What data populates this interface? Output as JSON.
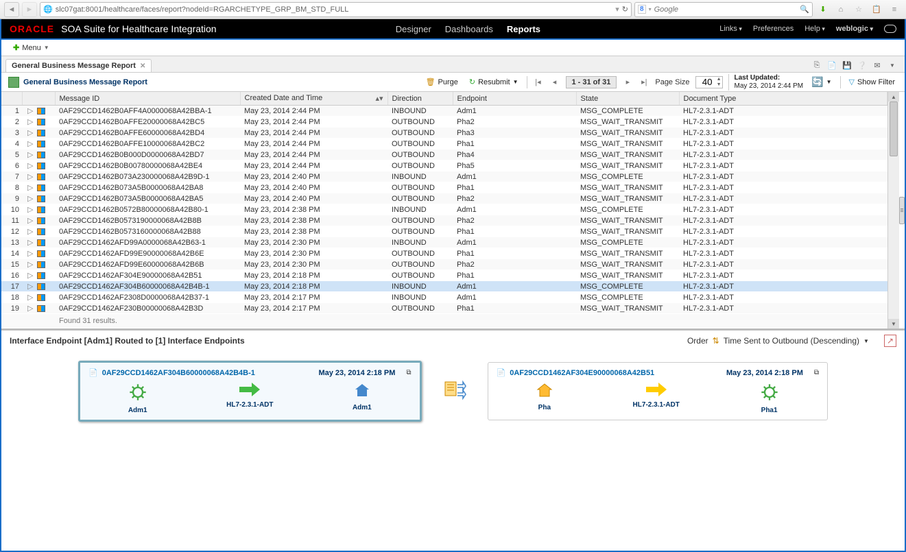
{
  "browser": {
    "url": "slc07gat:8001/healthcare/faces/report?nodeId=RGARCHETYPE_GRP_BM_STD_FULL",
    "search_placeholder": "Google"
  },
  "header": {
    "logo": "ORACLE",
    "suite": "SOA Suite for Healthcare Integration",
    "nav": {
      "designer": "Designer",
      "dashboards": "Dashboards",
      "reports": "Reports"
    },
    "links": "Links",
    "preferences": "Preferences",
    "help": "Help",
    "user": "weblogic"
  },
  "menu_bar": {
    "menu": "Menu"
  },
  "tab": {
    "title": "General Business Message Report"
  },
  "toolbar": {
    "report_title": "General Business Message Report",
    "purge": "Purge",
    "resubmit": "Resubmit",
    "page_info": "1 - 31 of 31",
    "page_size_lbl": "Page Size",
    "page_size_val": "40",
    "last_updated_lbl": "Last Updated:",
    "last_updated_val": "May 23, 2014 2:44 PM",
    "show_filter": "Show Filter"
  },
  "columns": {
    "c0": "",
    "c1": "Message ID",
    "c2": "Created Date and Time",
    "c3": "Direction",
    "c4": "Endpoint",
    "c5": "State",
    "c6": "Document Type"
  },
  "rows": [
    {
      "n": "1",
      "id": "0AF29CCD1462B0AFF4A0000068A42BBA-1",
      "dt": "May 23, 2014 2:44 PM",
      "dir": "INBOUND",
      "ep": "Adm1",
      "st": "MSG_COMPLETE",
      "doc": "HL7-2.3.1-ADT"
    },
    {
      "n": "2",
      "id": "0AF29CCD1462B0AFFE20000068A42BC5",
      "dt": "May 23, 2014 2:44 PM",
      "dir": "OUTBOUND",
      "ep": "Pha2",
      "st": "MSG_WAIT_TRANSMIT",
      "doc": "HL7-2.3.1-ADT"
    },
    {
      "n": "3",
      "id": "0AF29CCD1462B0AFFE60000068A42BD4",
      "dt": "May 23, 2014 2:44 PM",
      "dir": "OUTBOUND",
      "ep": "Pha3",
      "st": "MSG_WAIT_TRANSMIT",
      "doc": "HL7-2.3.1-ADT"
    },
    {
      "n": "4",
      "id": "0AF29CCD1462B0AFFE10000068A42BC2",
      "dt": "May 23, 2014 2:44 PM",
      "dir": "OUTBOUND",
      "ep": "Pha1",
      "st": "MSG_WAIT_TRANSMIT",
      "doc": "HL7-2.3.1-ADT"
    },
    {
      "n": "5",
      "id": "0AF29CCD1462B0B000D0000068A42BD7",
      "dt": "May 23, 2014 2:44 PM",
      "dir": "OUTBOUND",
      "ep": "Pha4",
      "st": "MSG_WAIT_TRANSMIT",
      "doc": "HL7-2.3.1-ADT"
    },
    {
      "n": "6",
      "id": "0AF29CCD1462B0B00780000068A42BE4",
      "dt": "May 23, 2014 2:44 PM",
      "dir": "OUTBOUND",
      "ep": "Pha5",
      "st": "MSG_WAIT_TRANSMIT",
      "doc": "HL7-2.3.1-ADT"
    },
    {
      "n": "7",
      "id": "0AF29CCD1462B073A230000068A42B9D-1",
      "dt": "May 23, 2014 2:40 PM",
      "dir": "INBOUND",
      "ep": "Adm1",
      "st": "MSG_COMPLETE",
      "doc": "HL7-2.3.1-ADT"
    },
    {
      "n": "8",
      "id": "0AF29CCD1462B073A5B0000068A42BA8",
      "dt": "May 23, 2014 2:40 PM",
      "dir": "OUTBOUND",
      "ep": "Pha1",
      "st": "MSG_WAIT_TRANSMIT",
      "doc": "HL7-2.3.1-ADT"
    },
    {
      "n": "9",
      "id": "0AF29CCD1462B073A5B0000068A42BA5",
      "dt": "May 23, 2014 2:40 PM",
      "dir": "OUTBOUND",
      "ep": "Pha2",
      "st": "MSG_WAIT_TRANSMIT",
      "doc": "HL7-2.3.1-ADT"
    },
    {
      "n": "10",
      "id": "0AF29CCD1462B0572B80000068A42B80-1",
      "dt": "May 23, 2014 2:38 PM",
      "dir": "INBOUND",
      "ep": "Adm1",
      "st": "MSG_COMPLETE",
      "doc": "HL7-2.3.1-ADT"
    },
    {
      "n": "11",
      "id": "0AF29CCD1462B0573190000068A42B8B",
      "dt": "May 23, 2014 2:38 PM",
      "dir": "OUTBOUND",
      "ep": "Pha2",
      "st": "MSG_WAIT_TRANSMIT",
      "doc": "HL7-2.3.1-ADT"
    },
    {
      "n": "12",
      "id": "0AF29CCD1462B0573160000068A42B88",
      "dt": "May 23, 2014 2:38 PM",
      "dir": "OUTBOUND",
      "ep": "Pha1",
      "st": "MSG_WAIT_TRANSMIT",
      "doc": "HL7-2.3.1-ADT"
    },
    {
      "n": "13",
      "id": "0AF29CCD1462AFD99A0000068A42B63-1",
      "dt": "May 23, 2014 2:30 PM",
      "dir": "INBOUND",
      "ep": "Adm1",
      "st": "MSG_COMPLETE",
      "doc": "HL7-2.3.1-ADT"
    },
    {
      "n": "14",
      "id": "0AF29CCD1462AFD99E90000068A42B6E",
      "dt": "May 23, 2014 2:30 PM",
      "dir": "OUTBOUND",
      "ep": "Pha1",
      "st": "MSG_WAIT_TRANSMIT",
      "doc": "HL7-2.3.1-ADT"
    },
    {
      "n": "15",
      "id": "0AF29CCD1462AFD99E60000068A42B6B",
      "dt": "May 23, 2014 2:30 PM",
      "dir": "OUTBOUND",
      "ep": "Pha2",
      "st": "MSG_WAIT_TRANSMIT",
      "doc": "HL7-2.3.1-ADT"
    },
    {
      "n": "16",
      "id": "0AF29CCD1462AF304E90000068A42B51",
      "dt": "May 23, 2014 2:18 PM",
      "dir": "OUTBOUND",
      "ep": "Pha1",
      "st": "MSG_WAIT_TRANSMIT",
      "doc": "HL7-2.3.1-ADT"
    },
    {
      "n": "17",
      "id": "0AF29CCD1462AF304B60000068A42B4B-1",
      "dt": "May 23, 2014 2:18 PM",
      "dir": "INBOUND",
      "ep": "Adm1",
      "st": "MSG_COMPLETE",
      "doc": "HL7-2.3.1-ADT"
    },
    {
      "n": "18",
      "id": "0AF29CCD1462AF2308D0000068A42B37-1",
      "dt": "May 23, 2014 2:17 PM",
      "dir": "INBOUND",
      "ep": "Adm1",
      "st": "MSG_COMPLETE",
      "doc": "HL7-2.3.1-ADT"
    },
    {
      "n": "19",
      "id": "0AF29CCD1462AF230B00000068A42B3D",
      "dt": "May 23, 2014 2:17 PM",
      "dir": "OUTBOUND",
      "ep": "Pha1",
      "st": "MSG_WAIT_TRANSMIT",
      "doc": "HL7-2.3.1-ADT"
    }
  ],
  "found": "Found 31 results.",
  "detail": {
    "title": "Interface Endpoint [Adm1] Routed to [1] Interface Endpoints",
    "order_lbl": "Order",
    "order_val": "Time Sent to Outbound (Descending)",
    "left": {
      "id": "0AF29CCD1462AF304B60000068A42B4B-1",
      "date": "May 23, 2014 2:18 PM",
      "a": "Adm1",
      "b": "HL7-2.3.1-ADT",
      "c": "Adm1"
    },
    "right": {
      "id": "0AF29CCD1462AF304E90000068A42B51",
      "date": "May 23, 2014 2:18 PM",
      "a": "Pha",
      "b": "HL7-2.3.1-ADT",
      "c": "Pha1"
    }
  }
}
